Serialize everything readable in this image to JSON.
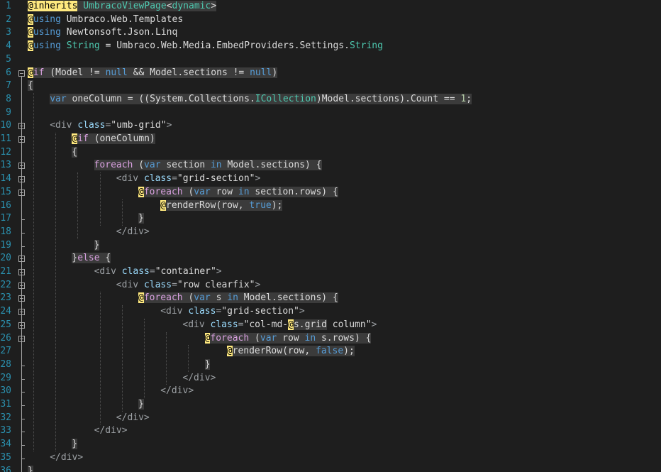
{
  "editor": {
    "language": "Razor (cshtml)",
    "colors": {
      "background": "#1e1e1e",
      "line_number": "#2b91af",
      "razor_marker_bg": "#ffe97f",
      "keyword": "#569cd6",
      "control_keyword": "#d8a0df",
      "type": "#4ec9b0",
      "block_highlight": "#3b3b3b"
    },
    "fold_icon": "collapse-minus-icon",
    "lines": [
      {
        "n": "1",
        "indent": 0,
        "fold": false,
        "segs": [
          [
            "rz",
            "@inherits"
          ],
          [
            "hl",
            " "
          ],
          [
            "hlty",
            "UmbracoViewPage"
          ],
          [
            "hl",
            "<"
          ],
          [
            "hlty",
            "dynamic"
          ],
          [
            "hl",
            ">"
          ]
        ]
      },
      {
        "n": "2",
        "indent": 0,
        "fold": false,
        "segs": [
          [
            "rzm",
            "@"
          ],
          [
            "kw",
            "using"
          ],
          [
            "",
            "Umbraco.Web.Templates"
          ]
        ]
      },
      {
        "n": "3",
        "indent": 0,
        "fold": false,
        "segs": [
          [
            "rzm",
            "@"
          ],
          [
            "kw",
            "using"
          ],
          [
            "",
            "Newtonsoft.Json.Linq"
          ]
        ]
      },
      {
        "n": "4",
        "indent": 0,
        "fold": false,
        "segs": [
          [
            "rzm",
            "@"
          ],
          [
            "kw",
            "using"
          ],
          [
            "",
            "",
            ""
          ],
          [
            "ty",
            "String"
          ],
          [
            "",
            " = Umbraco.Web.Media.EmbedProviders.Settings."
          ],
          [
            "ty",
            "String"
          ]
        ]
      },
      {
        "n": "5",
        "indent": 0,
        "fold": false,
        "segs": []
      },
      {
        "n": "6",
        "indent": 0,
        "fold": true,
        "segs": [
          [
            "rzm",
            "@"
          ],
          [
            "hlctl",
            "if"
          ],
          [
            "hl",
            " (Model != "
          ],
          [
            "hlkw",
            "null"
          ],
          [
            "hl",
            " && Model.sections != "
          ],
          [
            "hlkw",
            "null"
          ],
          [
            "hl",
            ")"
          ]
        ]
      },
      {
        "n": "7",
        "indent": 0,
        "fold": false,
        "segs": [
          [
            "hl",
            "{"
          ]
        ]
      },
      {
        "n": "8",
        "indent": 4,
        "fold": false,
        "segs": [
          [
            "hlkw",
            "var"
          ],
          [
            "hl",
            " oneColumn = ((System.Collections."
          ],
          [
            "hlty",
            "ICollection"
          ],
          [
            "hl",
            ")Model.sections).Count == "
          ],
          [
            "hlnum",
            "1"
          ],
          [
            "hl",
            ";"
          ]
        ]
      },
      {
        "n": "9",
        "indent": 0,
        "fold": false,
        "segs": []
      },
      {
        "n": "10",
        "indent": 4,
        "fold": true,
        "segs": [
          [
            "tag",
            "<div "
          ],
          [
            "attr",
            "class"
          ],
          [
            "tag",
            "="
          ],
          [
            "str",
            "\"umb-grid\""
          ],
          [
            "tag",
            ">"
          ]
        ]
      },
      {
        "n": "11",
        "indent": 8,
        "fold": true,
        "segs": [
          [
            "rzm",
            "@"
          ],
          [
            "hlctl",
            "if"
          ],
          [
            "hl",
            " (oneColumn)"
          ]
        ]
      },
      {
        "n": "12",
        "indent": 8,
        "fold": false,
        "segs": [
          [
            "hl",
            "{"
          ]
        ]
      },
      {
        "n": "13",
        "indent": 12,
        "fold": true,
        "segs": [
          [
            "hlctl",
            "foreach"
          ],
          [
            "hl",
            " ("
          ],
          [
            "hlkw",
            "var"
          ],
          [
            "hl",
            " section "
          ],
          [
            "hlkw",
            "in"
          ],
          [
            "hl",
            " Model.sections) {"
          ]
        ]
      },
      {
        "n": "14",
        "indent": 16,
        "fold": true,
        "segs": [
          [
            "tag",
            "<div "
          ],
          [
            "attr",
            "class"
          ],
          [
            "tag",
            "="
          ],
          [
            "str",
            "\"grid-section\""
          ],
          [
            "tag",
            ">"
          ]
        ]
      },
      {
        "n": "15",
        "indent": 20,
        "fold": true,
        "segs": [
          [
            "rzm",
            "@"
          ],
          [
            "hlctl",
            "foreach"
          ],
          [
            "hl",
            " ("
          ],
          [
            "hlkw",
            "var"
          ],
          [
            "hl",
            " row "
          ],
          [
            "hlkw",
            "in"
          ],
          [
            "hl",
            " section.rows) {"
          ]
        ]
      },
      {
        "n": "16",
        "indent": 24,
        "fold": false,
        "segs": [
          [
            "rzm",
            "@"
          ],
          [
            "hl",
            "renderRow(row, "
          ],
          [
            "hlkw",
            "true"
          ],
          [
            "hl",
            ");"
          ]
        ]
      },
      {
        "n": "17",
        "indent": 20,
        "fold": false,
        "segs": [
          [
            "hl",
            "}"
          ]
        ]
      },
      {
        "n": "18",
        "indent": 16,
        "fold": false,
        "segs": [
          [
            "tag",
            "</div>"
          ]
        ]
      },
      {
        "n": "19",
        "indent": 12,
        "fold": false,
        "segs": [
          [
            "hl",
            "}"
          ]
        ]
      },
      {
        "n": "20",
        "indent": 8,
        "fold": true,
        "segs": [
          [
            "hl",
            "}"
          ],
          [
            "hlctl",
            "else"
          ],
          [
            "hl",
            " {"
          ]
        ]
      },
      {
        "n": "21",
        "indent": 12,
        "fold": true,
        "segs": [
          [
            "tag",
            "<div "
          ],
          [
            "attr",
            "class"
          ],
          [
            "tag",
            "="
          ],
          [
            "str",
            "\"container\""
          ],
          [
            "tag",
            ">"
          ]
        ]
      },
      {
        "n": "22",
        "indent": 16,
        "fold": true,
        "segs": [
          [
            "tag",
            "<div "
          ],
          [
            "attr",
            "class"
          ],
          [
            "tag",
            "="
          ],
          [
            "str",
            "\"row clearfix\""
          ],
          [
            "tag",
            ">"
          ]
        ]
      },
      {
        "n": "23",
        "indent": 20,
        "fold": true,
        "segs": [
          [
            "rzm",
            "@"
          ],
          [
            "hlctl",
            "foreach"
          ],
          [
            "hl",
            " ("
          ],
          [
            "hlkw",
            "var"
          ],
          [
            "hl",
            " s "
          ],
          [
            "hlkw",
            "in"
          ],
          [
            "hl",
            " Model.sections) {"
          ]
        ]
      },
      {
        "n": "24",
        "indent": 24,
        "fold": true,
        "segs": [
          [
            "tag",
            "<div "
          ],
          [
            "attr",
            "class"
          ],
          [
            "tag",
            "="
          ],
          [
            "str",
            "\"grid-section\""
          ],
          [
            "tag",
            ">"
          ]
        ]
      },
      {
        "n": "25",
        "indent": 28,
        "fold": true,
        "segs": [
          [
            "tag",
            "<div "
          ],
          [
            "attr",
            "class"
          ],
          [
            "tag",
            "="
          ],
          [
            "str",
            "\"col-md-"
          ],
          [
            "rzm",
            "@"
          ],
          [
            "hl",
            "s.grid"
          ],
          [
            "str",
            " column\""
          ],
          [
            "tag",
            ">"
          ]
        ]
      },
      {
        "n": "26",
        "indent": 32,
        "fold": true,
        "segs": [
          [
            "rzm",
            "@"
          ],
          [
            "hlctl",
            "foreach"
          ],
          [
            "hl",
            " ("
          ],
          [
            "hlkw",
            "var"
          ],
          [
            "hl",
            " row "
          ],
          [
            "hlkw",
            "in"
          ],
          [
            "hl",
            " s.rows) {"
          ]
        ]
      },
      {
        "n": "27",
        "indent": 36,
        "fold": false,
        "segs": [
          [
            "rzm",
            "@"
          ],
          [
            "hl",
            "renderRow(row, "
          ],
          [
            "hlkw",
            "false"
          ],
          [
            "hl",
            ");"
          ]
        ]
      },
      {
        "n": "28",
        "indent": 32,
        "fold": false,
        "segs": [
          [
            "hl",
            "}"
          ]
        ]
      },
      {
        "n": "29",
        "indent": 28,
        "fold": false,
        "segs": [
          [
            "tag",
            "</div>"
          ]
        ]
      },
      {
        "n": "30",
        "indent": 24,
        "fold": false,
        "segs": [
          [
            "tag",
            "</div>"
          ]
        ]
      },
      {
        "n": "31",
        "indent": 20,
        "fold": false,
        "segs": [
          [
            "hl",
            "}"
          ]
        ]
      },
      {
        "n": "32",
        "indent": 16,
        "fold": false,
        "segs": [
          [
            "tag",
            "</div>"
          ]
        ]
      },
      {
        "n": "33",
        "indent": 12,
        "fold": false,
        "segs": [
          [
            "tag",
            "</div>"
          ]
        ]
      },
      {
        "n": "34",
        "indent": 8,
        "fold": false,
        "segs": [
          [
            "hl",
            "}"
          ]
        ]
      },
      {
        "n": "35",
        "indent": 4,
        "fold": false,
        "segs": [
          [
            "tag",
            "</div>"
          ]
        ]
      },
      {
        "n": "36",
        "indent": 0,
        "fold": false,
        "segs": [
          [
            "hl",
            "}"
          ]
        ]
      }
    ]
  }
}
